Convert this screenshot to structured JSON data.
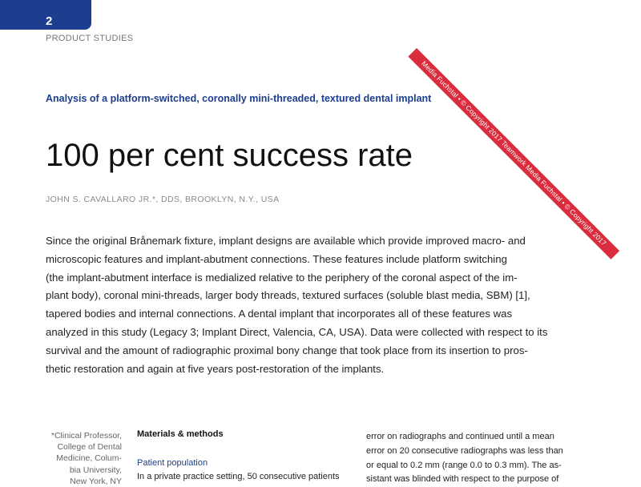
{
  "header": {
    "page_number": "2",
    "section": "PRODUCT STUDIES"
  },
  "article": {
    "kicker": "Analysis of a platform-switched, coronally mini-threaded, textured dental implant",
    "title": "100 per cent success rate",
    "byline": "JOHN S. CAVALLARO JR.*, DDS, BROOKLYN, N.Y., USA",
    "abstract_lines": [
      "Since the original Brånemark fixture, implant designs are available which provide improved macro- and",
      "microscopic features and implant-abutment connections. These features include platform switching",
      "(the implant-abutment interface is medialized relative to the periphery of the coronal aspect of the im-",
      "plant body), coronal mini-threads, larger body threads, textured surfaces (soluble blast media, SBM) [1],",
      "tapered bodies and internal connections. A dental implant that incorporates all of these features was",
      "analyzed in this study (Legacy 3; Implant Direct, Valencia, CA, USA). Data were collected with respect to its",
      "survival and the amount of radiographic proximal bony change that took place from its insertion to pros-",
      "thetic restoration and again at five years post-restoration of the implants."
    ]
  },
  "affiliation_lines": [
    "*Clinical Professor,",
    "College of Dental",
    "Medicine, Colum-",
    "bia University,",
    "New York, NY"
  ],
  "methods": {
    "heading": "Materials & methods",
    "subheading": "Patient population",
    "text": "In a private practice setting, 50 consecutive patients"
  },
  "right_column_lines": [
    "error on radiographs and continued until a mean",
    "error on 20 consecutive radiographs was less than",
    "or equal to 0.2 mm (range 0.0 to 0.3 mm). The as-",
    "sistant was blinded with respect to the purpose of"
  ],
  "watermark": {
    "text": "Media Fuchstal • © Copyright 2017 Teamwork Media Fuchstal • © Copyright 2017"
  },
  "colors": {
    "brand_blue": "#1c3e8e",
    "watermark_red": "#d92c3c"
  }
}
